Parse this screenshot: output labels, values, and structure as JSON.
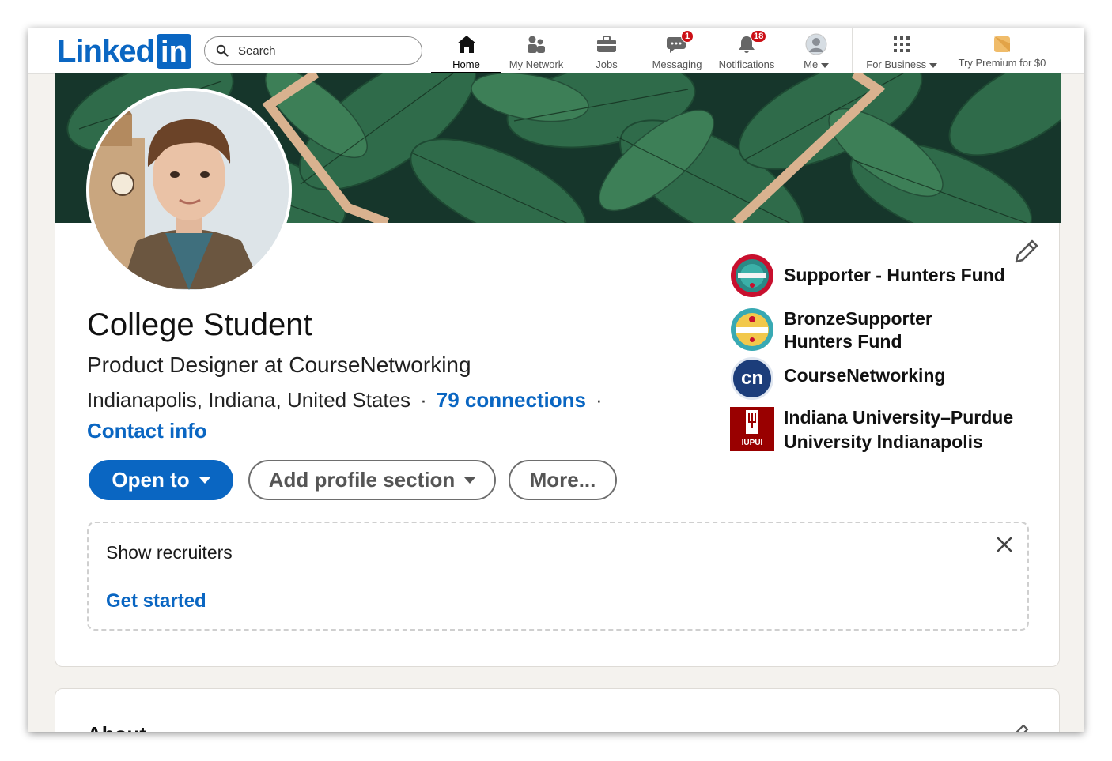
{
  "nav": {
    "logo_word": "Linked",
    "logo_box": "in",
    "search_placeholder": "Search",
    "items": [
      {
        "label": "Home",
        "icon": "home-icon"
      },
      {
        "label": "My Network",
        "icon": "network-icon"
      },
      {
        "label": "Jobs",
        "icon": "briefcase-icon"
      },
      {
        "label": "Messaging",
        "icon": "message-icon",
        "badge": "1"
      },
      {
        "label": "Notifications",
        "icon": "bell-icon",
        "badge": "18"
      },
      {
        "label": "Me",
        "icon": "avatar-icon"
      },
      {
        "label": "For Business",
        "icon": "grid-icon"
      },
      {
        "label": "Try Premium for $0",
        "icon": "premium-icon"
      }
    ]
  },
  "profile": {
    "name": "College Student",
    "headline": "Product Designer at CourseNetworking",
    "location": "Indianapolis, Indiana, United States",
    "connections": "79 connections",
    "contact_info": "Contact info",
    "buttons": {
      "open_to": "Open to",
      "add_section": "Add profile section",
      "more": "More..."
    }
  },
  "organizations": [
    {
      "line1": "Supporter - Hunters Fund",
      "line2": "",
      "logo": "supporter-badge-icon"
    },
    {
      "line1": "BronzeSupporter",
      "line2": "Hunters Fund",
      "logo": "bronze-badge-icon"
    },
    {
      "line1": "CourseNetworking",
      "line2": "",
      "logo": "coursenetworking-logo",
      "logo_text": "cn"
    },
    {
      "line1": "Indiana University–Purdue",
      "line2": "University Indianapolis",
      "logo": "iupui-logo",
      "logo_text": "IUPUI"
    }
  ],
  "recruiters": {
    "title": "Show recruiters",
    "cta": "Get started"
  },
  "about": {
    "title": "About"
  },
  "colors": {
    "accent": "#0a66c2",
    "badge_red": "#cc1016",
    "iu_crimson": "#990000",
    "cn_navy": "#1c3d7a"
  }
}
